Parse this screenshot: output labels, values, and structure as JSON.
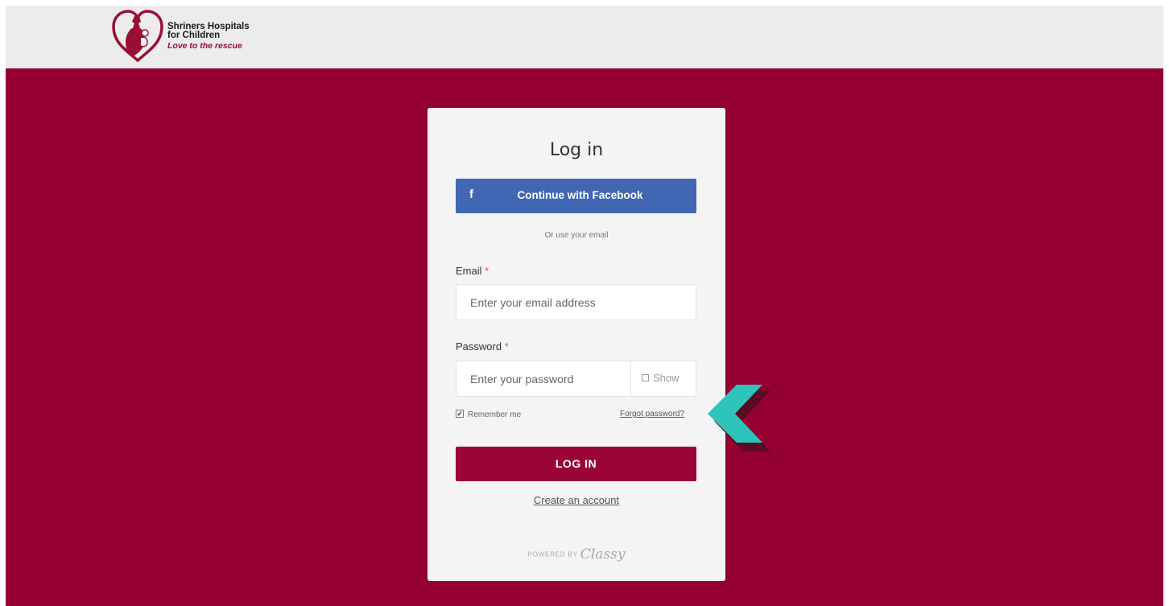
{
  "header": {
    "logo_name_line1": "Shriners Hospitals",
    "logo_name_line2": "for Children",
    "logo_tagline": "Love to the rescue"
  },
  "login": {
    "title": "Log in",
    "facebook_icon": "f",
    "facebook_label": "Continue with Facebook",
    "or_text": "Or use your email",
    "email_label": "Email",
    "email_placeholder": "Enter your email address",
    "password_label": "Password",
    "password_placeholder": "Enter your password",
    "required_marker": "*",
    "show_label": "Show",
    "remember_label": "Remember me",
    "remember_checked": true,
    "forgot_label": "Forgot password?",
    "login_button": "LOG IN",
    "create_account": "Create an account",
    "powered_by": "POWERED BY",
    "powered_brand": "Classy"
  },
  "colors": {
    "brand_background": "#930031",
    "facebook_blue": "#4267b2",
    "login_button": "#9b0535",
    "annotation_arrow": "#2cc4bb"
  },
  "icons": [
    "heart-logo-icon",
    "facebook-icon",
    "checkbox-icon",
    "pointer-arrow-icon"
  ]
}
